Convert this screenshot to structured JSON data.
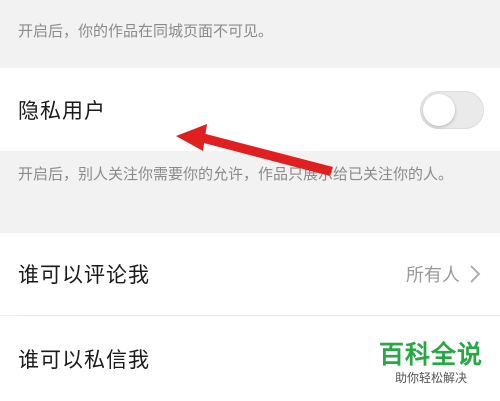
{
  "settings": {
    "note_top": "开启后，你的作品在同城页面不可见。",
    "private_user": {
      "label": "隐私用户",
      "toggle_on": false
    },
    "note_private": "开启后，别人关注你需要你的允许，作品只展示给已关注你的人。",
    "comment": {
      "label": "谁可以评论我",
      "value": "所有人"
    },
    "message": {
      "label": "谁可以私信我"
    }
  },
  "watermark": {
    "title": "百科全说",
    "subtitle": "助你轻松解决"
  },
  "colors": {
    "annotation_arrow": "#e02020",
    "watermark_green": "#28a745"
  },
  "icons": {
    "chevron": "chevron-right-icon",
    "arrow": "annotation-arrow-icon"
  }
}
